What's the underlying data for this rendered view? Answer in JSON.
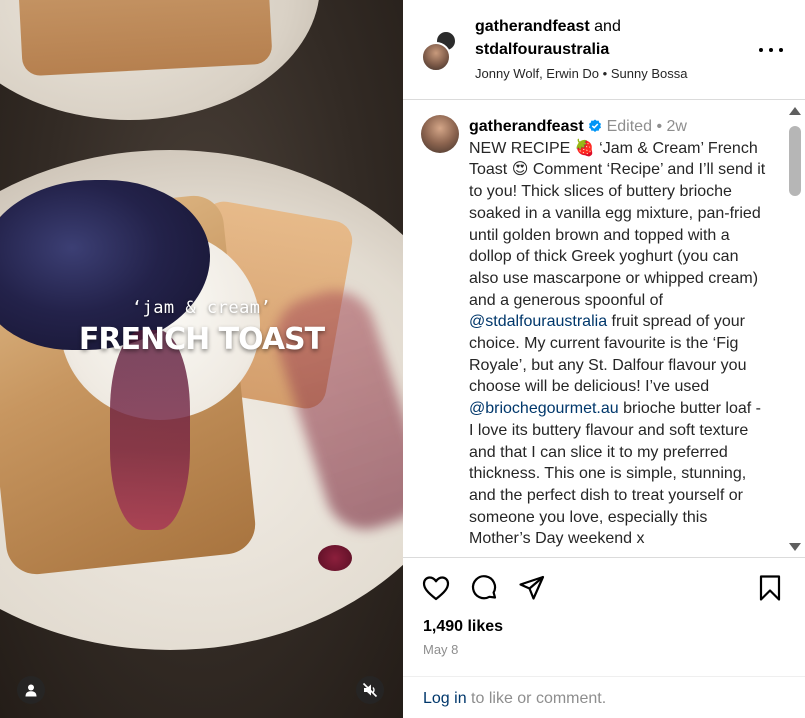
{
  "media": {
    "overlay_subtitle": "‘jam & cream’",
    "overlay_title": "FRENCH TOAST",
    "user_button_icon": "user-icon",
    "mute_button_icon": "muted-speaker-icon"
  },
  "header": {
    "author": "gatherandfeast",
    "and_text": "and",
    "collaborator": "stdalfouraustralia",
    "audio_artists": "Jonny Wolf, Erwin Do",
    "separator": "•",
    "audio_name": "Sunny Bossa",
    "more_icon": "more-options-icon"
  },
  "caption": {
    "username": "gatherandfeast",
    "verified_icon": "verified-badge-icon",
    "edited": "Edited",
    "dot": "•",
    "age": "2w",
    "text_1": "NEW RECIPE 🍓 ‘Jam & Cream’ French Toast 😍 Comment ‘Recipe’ and I’ll send it to you! Thick slices of buttery brioche soaked in a vanilla egg mixture, pan-fried until golden brown and topped with a dollop of thick Greek yoghurt (you can also use mascarpone or whipped cream) and a generous spoonful of ",
    "mention_1": "@stdalfouraustralia",
    "text_2": " fruit spread of your choice. My current favourite is the ‘Fig Royale’, but any St. Dalfour flavour you choose will be delicious! I’ve used ",
    "mention_2": "@briochegourmet.au",
    "text_3": " brioche butter loaf - I love its buttery flavour and soft texture and that I can slice it to my preferred thickness. This one is simple, stunning, and the perfect dish to treat yourself or someone you love, especially this Mother’s Day weekend x"
  },
  "actions": {
    "like_icon": "heart-icon",
    "comment_icon": "comment-icon",
    "share_icon": "share-icon",
    "save_icon": "bookmark-icon",
    "likes": "1,490 likes",
    "date": "May 8",
    "login_link": "Log in",
    "login_suffix": " to like or comment."
  }
}
